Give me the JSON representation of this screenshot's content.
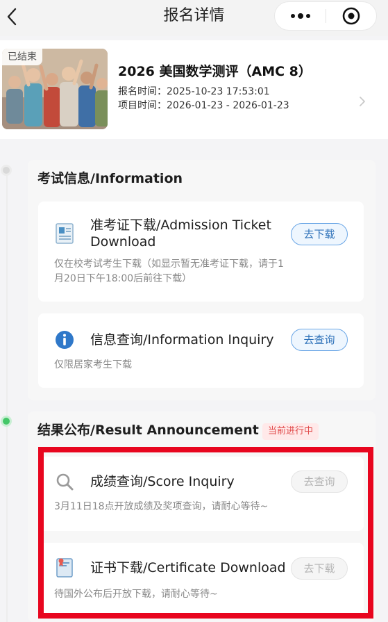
{
  "header": {
    "title": "报名详情"
  },
  "event": {
    "status_badge": "已结束",
    "title": "2026 美国数学测评（AMC 8）",
    "registration_time_label": "报名时间：",
    "registration_time": "2025-10-23 17:53:01",
    "project_time_label": "项目时间：",
    "project_time": "2026-01-23 - 2026-01-23"
  },
  "sections": [
    {
      "title": "考试信息/Information",
      "items": [
        {
          "icon": "admission-ticket-icon",
          "label_line1": "准考证下载/Admission Ticket",
          "label_line2": "Download",
          "button": "去下载",
          "desc_line1": "仅在校考试考生下载（如显示暂无准考证下载，请于1",
          "desc_line2": "月20日下午18:00后前往下载）"
        },
        {
          "icon": "info-icon",
          "label": "信息查询/Information Inquiry",
          "button": "去查询",
          "desc": "仅限居家考生下载"
        }
      ]
    },
    {
      "title": "结果公布/Result Announcement",
      "status": "当前进行中",
      "items": [
        {
          "icon": "search-icon",
          "label": "成绩查询/Score Inquiry",
          "button": "去查询",
          "desc": "3月11日18点开放成绩及奖项查询，请耐心等待~"
        },
        {
          "icon": "certificate-icon",
          "label": "证书下载/Certificate Download",
          "button": "去下载",
          "desc": "待国外公布后开放下载，请耐心等待~"
        }
      ]
    }
  ],
  "colors": {
    "accent_blue": "#2a6fb8",
    "status_red": "#e14c4c",
    "highlight_red": "#e8061f",
    "active_green": "#44c768"
  }
}
